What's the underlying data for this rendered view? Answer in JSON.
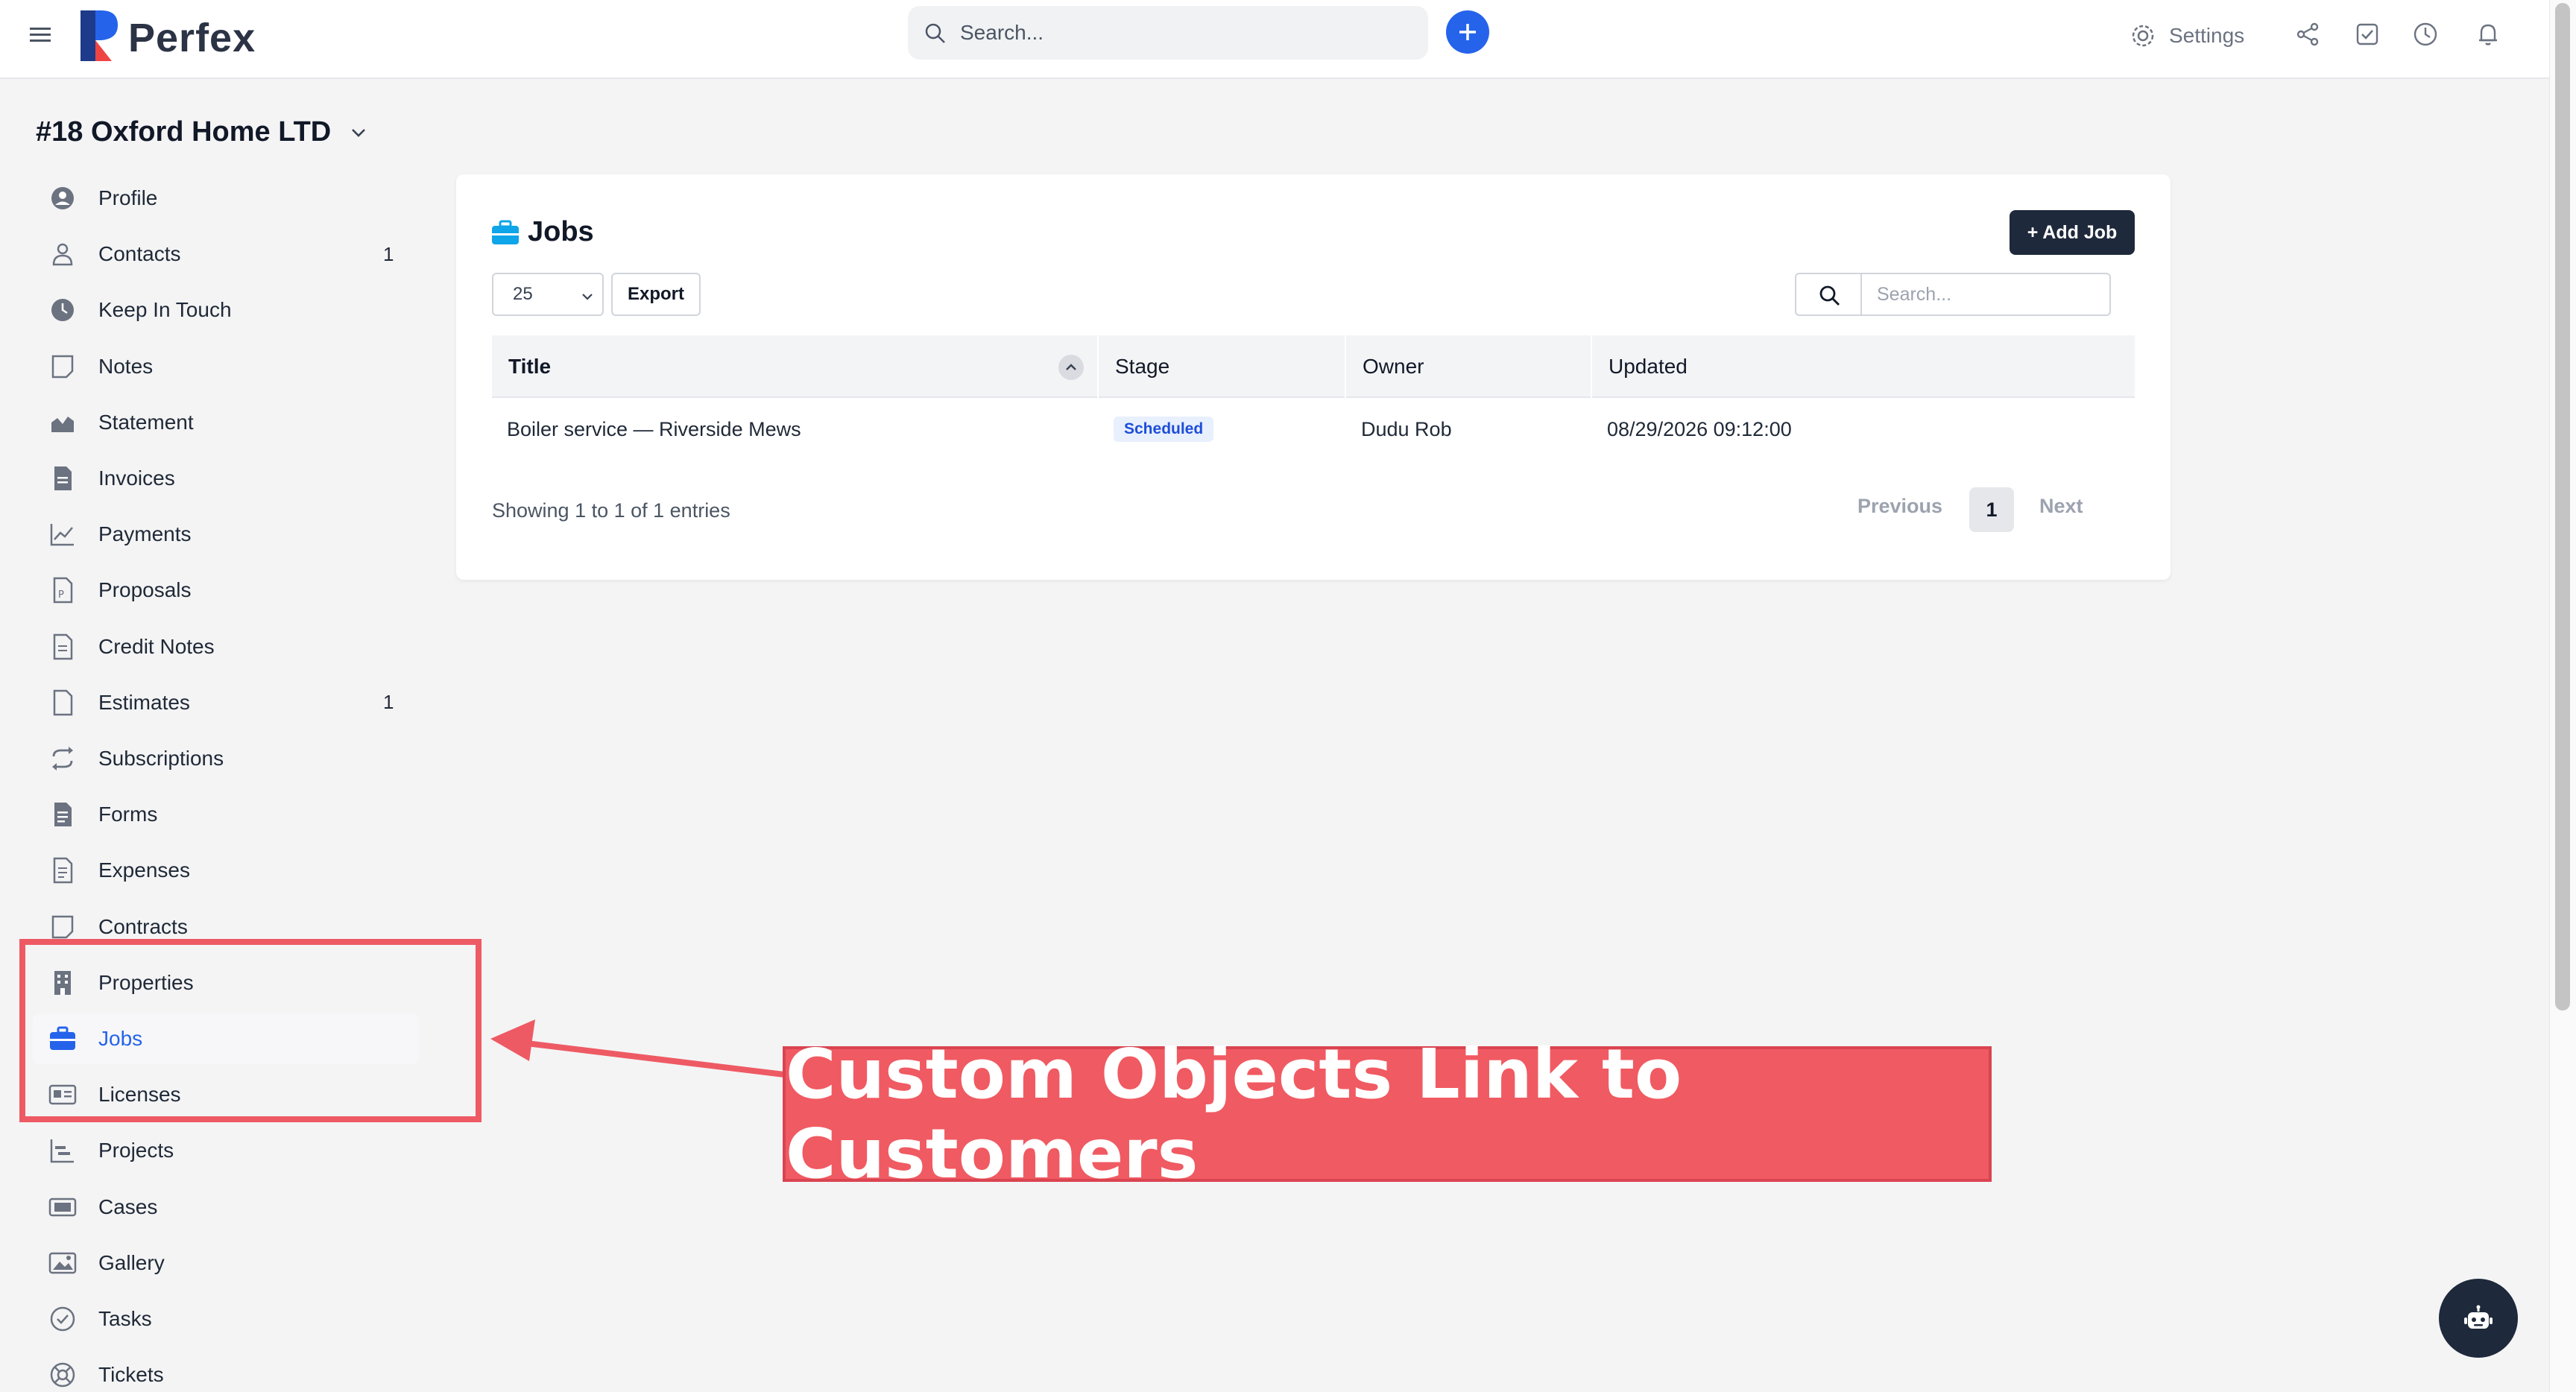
{
  "app": {
    "brand": "Perfex",
    "search_placeholder": "Search...",
    "settings_label": "Settings"
  },
  "customer": {
    "title": "#18 Oxford Home LTD"
  },
  "sidebar": {
    "items": [
      {
        "label": "Profile",
        "icon": "user-circle-icon",
        "count": ""
      },
      {
        "label": "Contacts",
        "icon": "user-icon",
        "count": "1"
      },
      {
        "label": "Keep In Touch",
        "icon": "clock-icon",
        "count": ""
      },
      {
        "label": "Notes",
        "icon": "note-icon",
        "count": ""
      },
      {
        "label": "Statement",
        "icon": "area-chart-icon",
        "count": ""
      },
      {
        "label": "Invoices",
        "icon": "file-icon",
        "count": ""
      },
      {
        "label": "Payments",
        "icon": "line-chart-icon",
        "count": ""
      },
      {
        "label": "Proposals",
        "icon": "proposal-icon",
        "count": ""
      },
      {
        "label": "Credit Notes",
        "icon": "document-icon",
        "count": ""
      },
      {
        "label": "Estimates",
        "icon": "file-outline-icon",
        "count": "1"
      },
      {
        "label": "Subscriptions",
        "icon": "repeat-icon",
        "count": ""
      },
      {
        "label": "Forms",
        "icon": "form-icon",
        "count": ""
      },
      {
        "label": "Expenses",
        "icon": "receipt-icon",
        "count": ""
      },
      {
        "label": "Contracts",
        "icon": "contract-icon",
        "count": ""
      },
      {
        "label": "Properties",
        "icon": "building-icon",
        "count": ""
      },
      {
        "label": "Jobs",
        "icon": "briefcase-icon",
        "count": "",
        "active": true
      },
      {
        "label": "Licenses",
        "icon": "id-card-icon",
        "count": ""
      },
      {
        "label": "Projects",
        "icon": "chart-bars-icon",
        "count": ""
      },
      {
        "label": "Cases",
        "icon": "ticket-icon",
        "count": ""
      },
      {
        "label": "Gallery",
        "icon": "image-icon",
        "count": ""
      },
      {
        "label": "Tasks",
        "icon": "check-circle-icon",
        "count": ""
      },
      {
        "label": "Tickets",
        "icon": "lifebuoy-icon",
        "count": ""
      }
    ]
  },
  "jobs": {
    "title": "Jobs",
    "add_label": "+ Add Job",
    "page_size": "25",
    "export_label": "Export",
    "search_placeholder": "Search...",
    "columns": {
      "title": "Title",
      "stage": "Stage",
      "owner": "Owner",
      "updated": "Updated"
    },
    "rows": [
      {
        "title": "Boiler service — Riverside Mews",
        "stage": "Scheduled",
        "owner": "Dudu Rob",
        "updated": "08/29/2026 09:12:00"
      }
    ],
    "showing": "Showing 1 to 1 of 1 entries",
    "pager": {
      "previous": "Previous",
      "current": "1",
      "next": "Next"
    }
  },
  "annotation": {
    "text": "Custom Objects Link to Customers"
  },
  "colors": {
    "accent": "#2563eb",
    "dark": "#1e293b",
    "annotation": "#f05a62"
  }
}
